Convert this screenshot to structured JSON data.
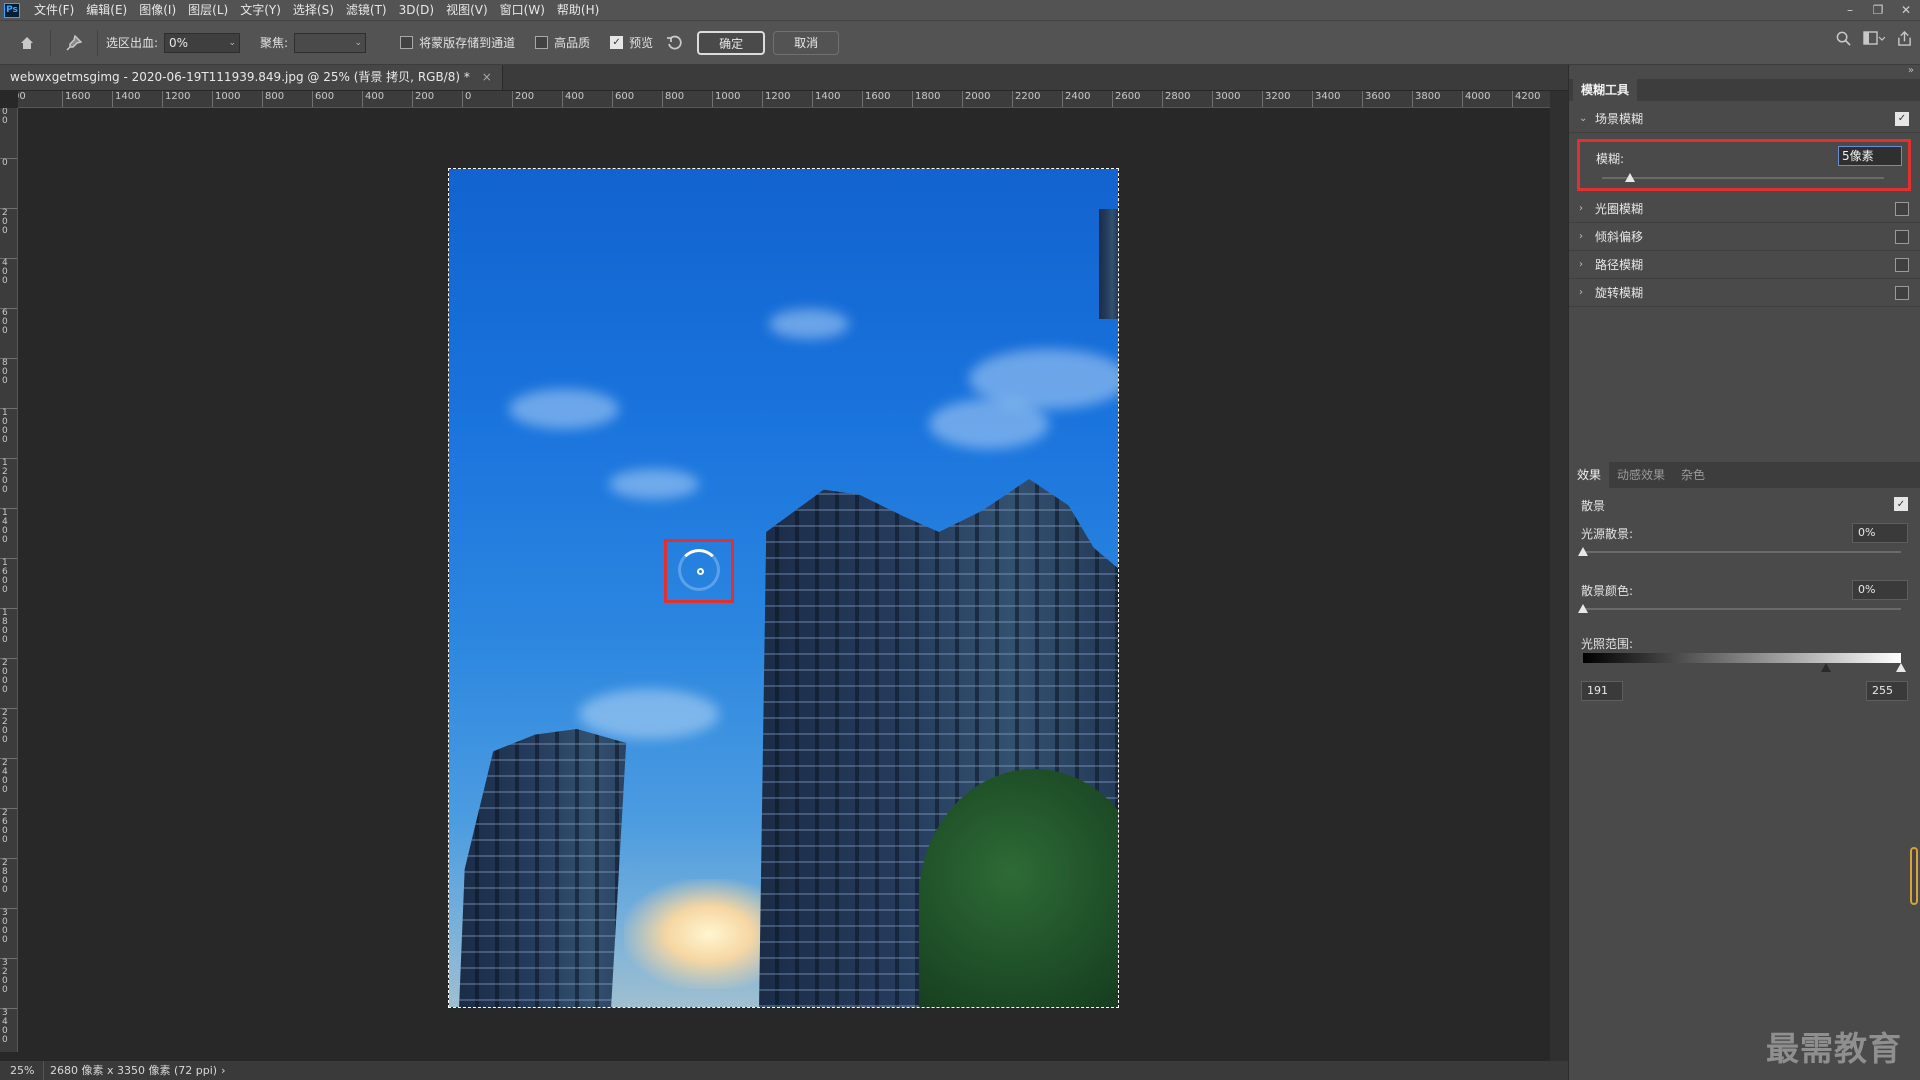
{
  "app": {
    "logo": "Ps"
  },
  "menu": [
    "文件(F)",
    "编辑(E)",
    "图像(I)",
    "图层(L)",
    "文字(Y)",
    "选择(S)",
    "滤镜(T)",
    "3D(D)",
    "视图(V)",
    "窗口(W)",
    "帮助(H)"
  ],
  "window_controls": {
    "minimize": "–",
    "restore": "❐",
    "close": "✕"
  },
  "options": {
    "output_label": "选区出血:",
    "output_value": "0%",
    "focus_label": "聚焦:",
    "focus_value": "",
    "save_mask_label": "将蒙版存储到通道",
    "save_mask_checked": false,
    "high_quality_label": "高品质",
    "high_quality_checked": false,
    "preview_label": "预览",
    "preview_checked": true,
    "ok_label": "确定",
    "cancel_label": "取消"
  },
  "document": {
    "tab_title": "webwxgetmsgimg - 2020-06-19T111939.849.jpg @ 25% (背景 拷贝, RGB/8) *",
    "close": "×"
  },
  "ruler": {
    "h_labels": [
      "00",
      "1600",
      "1400",
      "1200",
      "1000",
      "800",
      "600",
      "400",
      "200",
      "0",
      "200",
      "400",
      "600",
      "800",
      "1000",
      "1200",
      "1400",
      "1600",
      "1800",
      "2000",
      "2200",
      "2400",
      "2600",
      "2800",
      "3000",
      "3200",
      "3400",
      "3600",
      "3800",
      "4000",
      "4200"
    ],
    "v_labels": [
      "2 0 0",
      "0",
      "2 0 0",
      "4 0 0",
      "6 0 0",
      "8 0 0",
      "1 0 0 0",
      "1 2 0 0",
      "1 4 0 0",
      "1 6 0 0",
      "1 8 0 0",
      "2 0 0 0",
      "2 2 0 0",
      "2 4 0 0",
      "2 6 0 0",
      "2 8 0 0",
      "3 0 0 0",
      "3 2 0 0",
      "3 4 0 0"
    ]
  },
  "status": {
    "zoom": "25%",
    "info": "2680 像素 x 3350 像素 (72 ppi)",
    "arrow": "›"
  },
  "panel": {
    "collapse": "»",
    "title": "模糊工具",
    "field_blur": {
      "label": "场景模糊",
      "checked": true,
      "blur_label": "模糊:",
      "blur_value": "5像素",
      "blur_slider": 0.1
    },
    "other_blurs": [
      {
        "label": "光圈模糊",
        "checked": false
      },
      {
        "label": "倾斜偏移",
        "checked": false
      },
      {
        "label": "路径模糊",
        "checked": false
      },
      {
        "label": "旋转模糊",
        "checked": false
      }
    ],
    "effects_tabs": [
      "效果",
      "动感效果",
      "杂色"
    ],
    "bokeh": {
      "label": "散景",
      "checked": true
    },
    "light_bokeh": {
      "label": "光源散景:",
      "value": "0%"
    },
    "bokeh_color": {
      "label": "散景颜色:",
      "value": "0%"
    },
    "light_range": {
      "label": "光照范围:",
      "low": "191",
      "high": "255"
    }
  },
  "watermark": "最需教育",
  "colors": {
    "accent_highlight": "#e03030",
    "panel_bg": "#4a4a4a",
    "chrome_bg": "#535353",
    "canvas_bg": "#282828"
  }
}
